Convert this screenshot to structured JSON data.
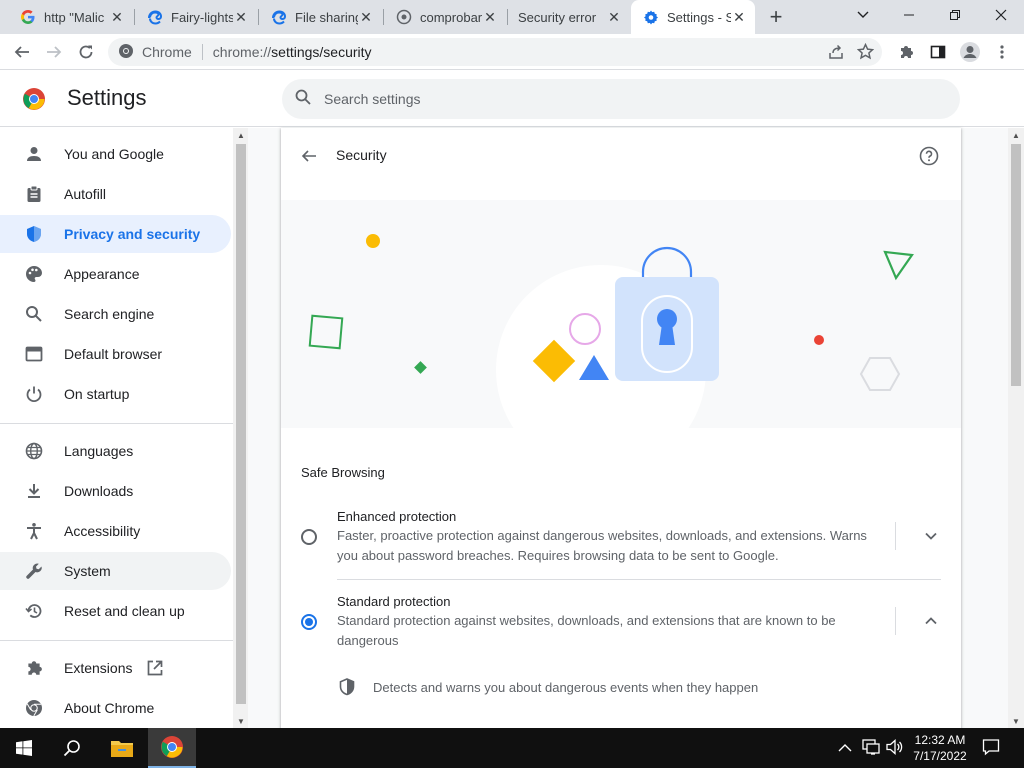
{
  "tabs": [
    {
      "title": "http \"Malic",
      "icon": "google-g-icon"
    },
    {
      "title": "Fairy-lights",
      "icon": "edge-icon"
    },
    {
      "title": "File sharing",
      "icon": "edge-icon"
    },
    {
      "title": "comprobar",
      "icon": "globe-icon"
    },
    {
      "title": "Security error",
      "icon": "none"
    },
    {
      "title": "Settings - S",
      "icon": "settings-gear-icon",
      "active": true
    }
  ],
  "omnibox": {
    "site_label": "Chrome",
    "url_prefix": "chrome://",
    "url_path": "settings/security"
  },
  "settings": {
    "title": "Settings",
    "search_placeholder": "Search settings"
  },
  "sidebar": {
    "items": [
      {
        "label": "You and Google",
        "icon": "person-icon"
      },
      {
        "label": "Autofill",
        "icon": "clipboard-icon"
      },
      {
        "label": "Privacy and security",
        "icon": "shield-icon",
        "selected": true
      },
      {
        "label": "Appearance",
        "icon": "palette-icon"
      },
      {
        "label": "Search engine",
        "icon": "search-icon"
      },
      {
        "label": "Default browser",
        "icon": "browser-window-icon"
      },
      {
        "label": "On startup",
        "icon": "power-icon"
      },
      {
        "label": "Languages",
        "icon": "globe-icon"
      },
      {
        "label": "Downloads",
        "icon": "download-icon"
      },
      {
        "label": "Accessibility",
        "icon": "accessibility-icon"
      },
      {
        "label": "System",
        "icon": "wrench-icon"
      },
      {
        "label": "Reset and clean up",
        "icon": "restore-icon"
      },
      {
        "label": "Extensions",
        "icon": "puzzle-icon"
      },
      {
        "label": "About Chrome",
        "icon": "chrome-icon"
      }
    ]
  },
  "page": {
    "title": "Security",
    "section_title": "Safe Browsing",
    "options": [
      {
        "title": "Enhanced protection",
        "description": "Faster, proactive protection against dangerous websites, downloads, and extensions. Warns you about password breaches. Requires browsing data to be sent to Google.",
        "selected": false,
        "expanded": false
      },
      {
        "title": "Standard protection",
        "description": "Standard protection against websites, downloads, and extensions that are known to be dangerous",
        "selected": true,
        "expanded": true
      }
    ],
    "standard_detail": "Detects and warns you about dangerous events when they happen"
  },
  "taskbar": {
    "time": "12:32 AM",
    "date": "7/17/2022"
  },
  "colors": {
    "accent": "#1a73e8",
    "selected_nav_bg": "#e8f0fe"
  }
}
